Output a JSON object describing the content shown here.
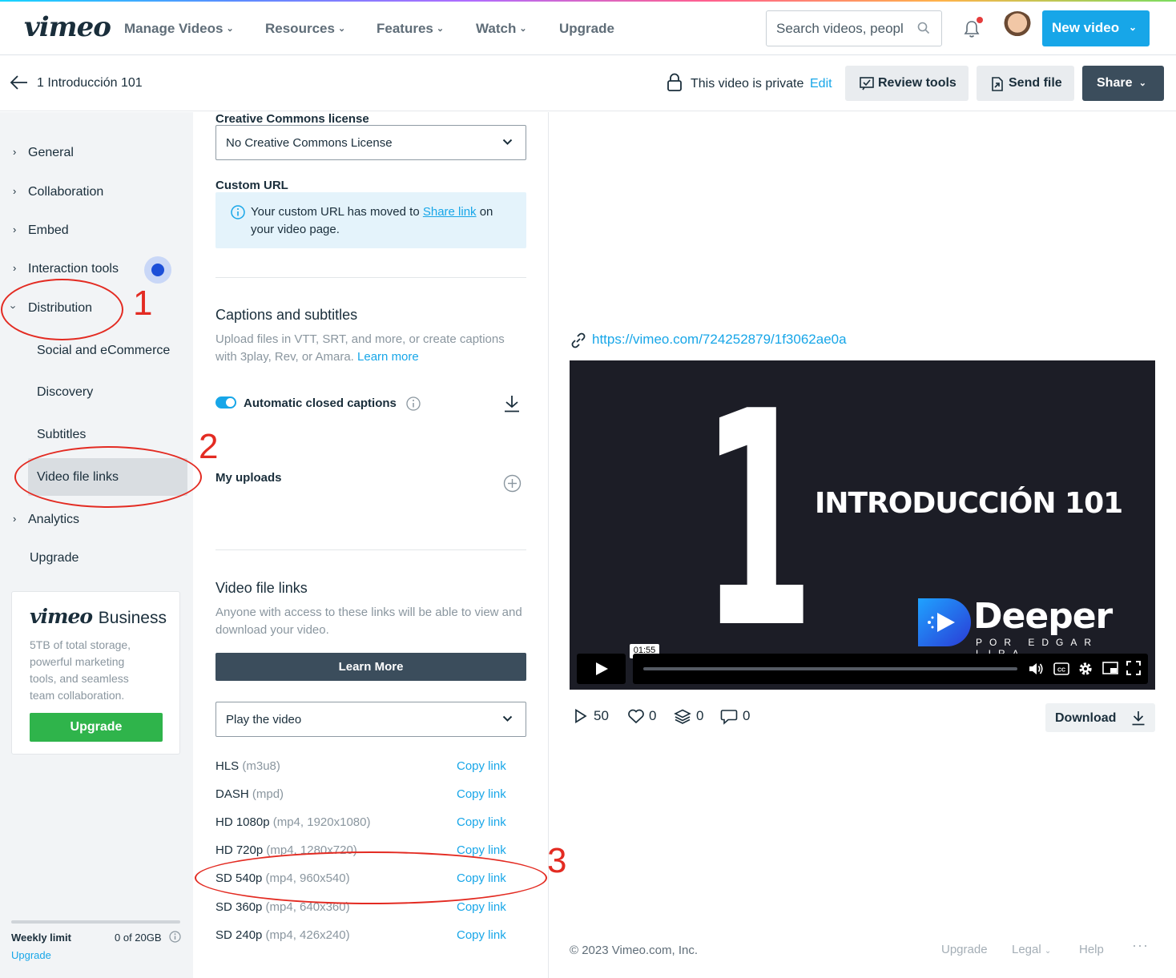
{
  "topnav": {
    "logo": "vimeo",
    "items": [
      {
        "label": "Manage Videos"
      },
      {
        "label": "Resources"
      },
      {
        "label": "Features"
      },
      {
        "label": "Watch"
      },
      {
        "label": "Upgrade"
      }
    ],
    "search_placeholder": "Search videos, people...",
    "search_value": "Search videos, peopl",
    "new_video_label": "New video"
  },
  "subbar": {
    "video_title": "1 Introducción 101",
    "privacy_text": "This video is private",
    "edit_label": "Edit",
    "review_tools_label": "Review tools",
    "send_file_label": "Send file",
    "share_label": "Share"
  },
  "sidebar": {
    "items": [
      {
        "label": "General"
      },
      {
        "label": "Collaboration"
      },
      {
        "label": "Embed"
      },
      {
        "label": "Interaction tools"
      },
      {
        "label": "Distribution"
      }
    ],
    "sub_items": [
      {
        "label": "Social and eCommerce"
      },
      {
        "label": "Discovery"
      },
      {
        "label": "Subtitles"
      },
      {
        "label": "Video file links"
      }
    ],
    "analytics_label": "Analytics",
    "upgrade_label": "Upgrade",
    "business_card": {
      "logo": "vimeo",
      "logo_suffix": "Business",
      "description": "5TB of total storage, powerful marketing tools, and seamless team collaboration.",
      "button_label": "Upgrade"
    },
    "weekly_limit": {
      "label": "Weekly limit",
      "value": "0 of 20GB",
      "upgrade_label": "Upgrade"
    }
  },
  "middle": {
    "cc_label": "Creative Commons license",
    "cc_value": "No Creative Commons License",
    "custom_url_label": "Custom URL",
    "custom_url_info_pre": "Your custom URL has moved to",
    "custom_url_info_link": "Share link",
    "custom_url_info_post": "on your video page.",
    "captions_title": "Captions and subtitles",
    "captions_desc": "Upload files in VTT, SRT, and more, or create captions with 3play, Rev, or Amara.",
    "captions_learn_more": "Learn more",
    "auto_captions_label": "Automatic closed captions",
    "my_uploads_label": "My uploads",
    "file_links_title": "Video file links",
    "file_links_desc": "Anyone with access to these links will be able to view and download your video.",
    "learn_more_button": "Learn More",
    "play_select_value": "Play the video",
    "copy_label": "Copy link",
    "links": [
      {
        "name": "HLS",
        "format": "(m3u8)"
      },
      {
        "name": "DASH",
        "format": "(mpd)"
      },
      {
        "name": "HD 1080p",
        "format": "(mp4, 1920x1080)"
      },
      {
        "name": "HD 720p",
        "format": "(mp4, 1280x720)"
      },
      {
        "name": "SD 540p",
        "format": "(mp4, 960x540)"
      },
      {
        "name": "SD 360p",
        "format": "(mp4, 640x360)"
      },
      {
        "name": "SD 240p",
        "format": "(mp4, 426x240)"
      }
    ]
  },
  "right": {
    "video_url": "https://vimeo.com/724252879/1f3062ae0a",
    "player": {
      "big_number": "1",
      "title_text": "INTRODUCCIÓN 101",
      "brand_text": "Deeper",
      "brand_sub": "POR EDGAR LIRA",
      "time_tooltip": "01:55"
    },
    "stats": {
      "plays": "50",
      "likes": "0",
      "collections": "0",
      "comments": "0"
    },
    "download_label": "Download"
  },
  "footer": {
    "copyright": "© 2023 Vimeo.com, Inc.",
    "upgrade": "Upgrade",
    "legal": "Legal",
    "help": "Help",
    "more": "···"
  },
  "annotations": {
    "one": "1",
    "two": "2",
    "three": "3"
  },
  "colors": {
    "accent": "#17a6e8",
    "dark_button": "#3b4d5c",
    "upgrade_green": "#2fb44b",
    "annotation_red": "#e32b22"
  }
}
